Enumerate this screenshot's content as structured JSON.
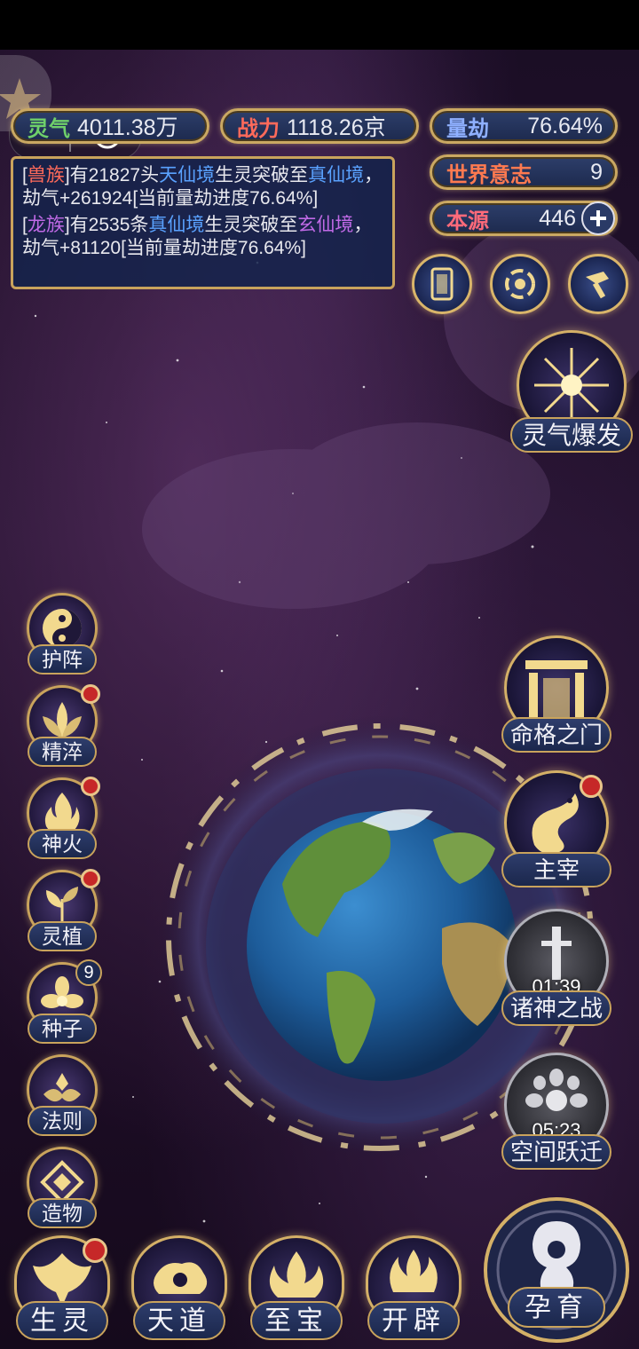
{
  "resources": {
    "lingqi": {
      "label": "灵气",
      "value": "4011.38万"
    },
    "zhanli": {
      "label": "战力",
      "value": "1118.26京"
    },
    "liangjie": {
      "label": "量劫",
      "value": "76.64%"
    },
    "world_will": {
      "label": "世界意志",
      "value": "9"
    },
    "benyuan": {
      "label": "本源",
      "value": "446"
    }
  },
  "log": [
    {
      "p1": "[",
      "tribe": "兽族",
      "p2": "]有21827头",
      "from": "天仙境",
      "p3": "生灵突破至",
      "to": "真仙境",
      "p4": "，劫气+261924[当前量劫进度76.64%]"
    },
    {
      "p1": "[",
      "tribe": "龙族",
      "p2": "]有2535条",
      "from": "真仙境",
      "p3": "生灵突破至",
      "to": "玄仙境",
      "p4": "，劫气+81120[当前量劫进度76.64%]"
    }
  ],
  "lingqi_burst": {
    "label": "灵气爆发"
  },
  "left_menu": [
    {
      "label": "护阵",
      "icon": "yin-yang-icon",
      "dot": false
    },
    {
      "label": "精淬",
      "icon": "lotus-icon",
      "dot": true
    },
    {
      "label": "神火",
      "icon": "flame-icon",
      "dot": true
    },
    {
      "label": "灵植",
      "icon": "plant-icon",
      "dot": true
    },
    {
      "label": "种子",
      "icon": "seed-icon",
      "badge": "9"
    },
    {
      "label": "法则",
      "icon": "rule-icon",
      "dot": false
    },
    {
      "label": "造物",
      "icon": "creation-icon",
      "dot": false
    }
  ],
  "right_menu": {
    "fate_gate": {
      "label": "命格之门"
    },
    "master": {
      "label": "主宰"
    },
    "gods_war": {
      "label": "诸神之战",
      "timer": "01:39"
    },
    "space_jump": {
      "label": "空间跃迁",
      "timer": "05:23"
    }
  },
  "bottom_menu": [
    {
      "label": "生灵",
      "dot": true
    },
    {
      "label": "天道",
      "dot": false
    },
    {
      "label": "至宝",
      "dot": false
    },
    {
      "label": "开辟",
      "dot": false
    }
  ],
  "nurture": {
    "label": "孕育"
  },
  "colors": {
    "gold": "#c9a35c",
    "panel": "#1d2a4e",
    "notice_red": "#c62828"
  }
}
